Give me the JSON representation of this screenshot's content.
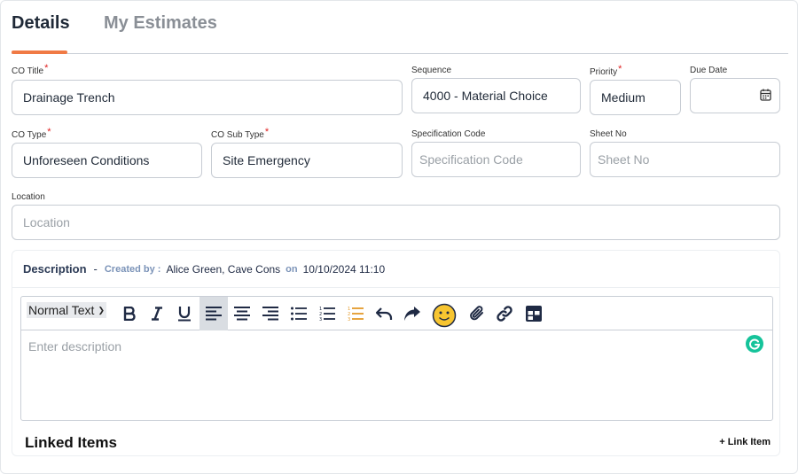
{
  "tabs": [
    {
      "label": "Details",
      "active": true
    },
    {
      "label": "My Estimates",
      "active": false
    }
  ],
  "form": {
    "co_title": {
      "label": "CO Title",
      "required": true,
      "value": "Drainage Trench"
    },
    "sequence": {
      "label": "Sequence",
      "value": "4000 - Material Choice"
    },
    "priority": {
      "label": "Priority",
      "required": true,
      "value": "Medium"
    },
    "due_date": {
      "label": "Due Date",
      "value": ""
    },
    "co_type": {
      "label": "CO Type",
      "required": true,
      "value": "Unforeseen Conditions"
    },
    "co_sub_type": {
      "label": "CO Sub Type",
      "required": true,
      "value": "Site Emergency"
    },
    "specification_code": {
      "label": "Specification Code",
      "placeholder": "Specification Code",
      "value": ""
    },
    "sheet_no": {
      "label": "Sheet No",
      "placeholder": "Sheet No",
      "value": ""
    },
    "location": {
      "label": "Location",
      "placeholder": "Location",
      "value": ""
    }
  },
  "description": {
    "title": "Description",
    "dash": "-",
    "created_by_label": "Created by :",
    "created_by": "Alice Green, Cave Cons",
    "on_label": "on",
    "timestamp": "10/10/2024 11:10",
    "toolbar": {
      "format_select": "Normal Text",
      "icons": [
        "bold-icon",
        "italic-icon",
        "underline-icon",
        "align-left-icon",
        "align-center-icon",
        "align-right-icon",
        "bullet-list-icon",
        "numbered-list-icon",
        "checklist-icon",
        "undo-icon",
        "redo-icon",
        "emoji-icon",
        "attachment-icon",
        "link-icon",
        "table-icon"
      ]
    },
    "placeholder": "Enter description"
  },
  "linked_items": {
    "title": "Linked Items",
    "link_button": "+ Link Item"
  },
  "colors": {
    "accent": "#f07a45",
    "required": "#e02020",
    "meta_label": "#7b93b8",
    "checklist": "#e39a2b",
    "grammarly": "#15c39a"
  }
}
